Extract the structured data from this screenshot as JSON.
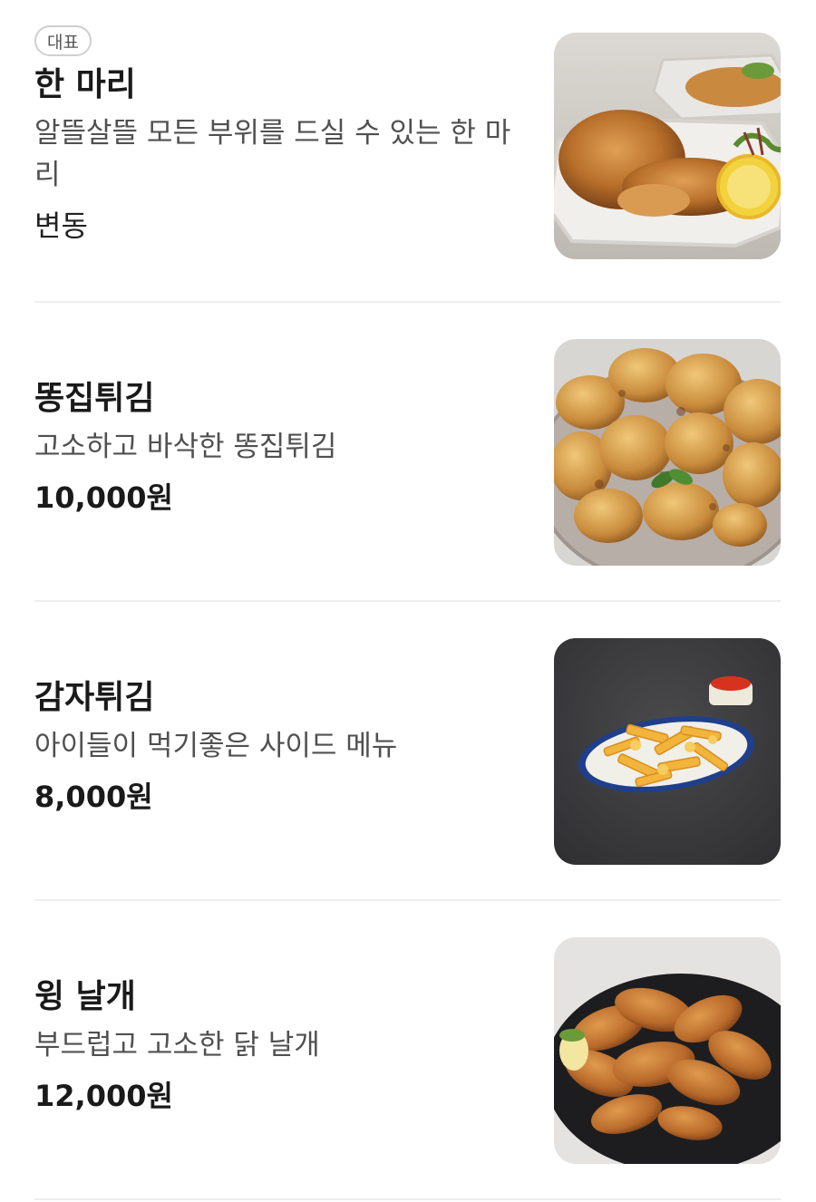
{
  "menu": {
    "items": [
      {
        "badge": "대표",
        "name": "한 마리",
        "description": "알뜰살뜰 모든 부위를 드실 수 있는 한 마리",
        "price": "변동"
      },
      {
        "name": "똥집튀김",
        "description": "고소하고 바삭한 똥집튀김",
        "price": "10,000원"
      },
      {
        "name": "감자튀김",
        "description": "아이들이 먹기좋은 사이드 메뉴",
        "price": "8,000원"
      },
      {
        "name": "윙 날개",
        "description": "부드럽고 고소한 닭 날개",
        "price": "12,000원"
      }
    ]
  }
}
